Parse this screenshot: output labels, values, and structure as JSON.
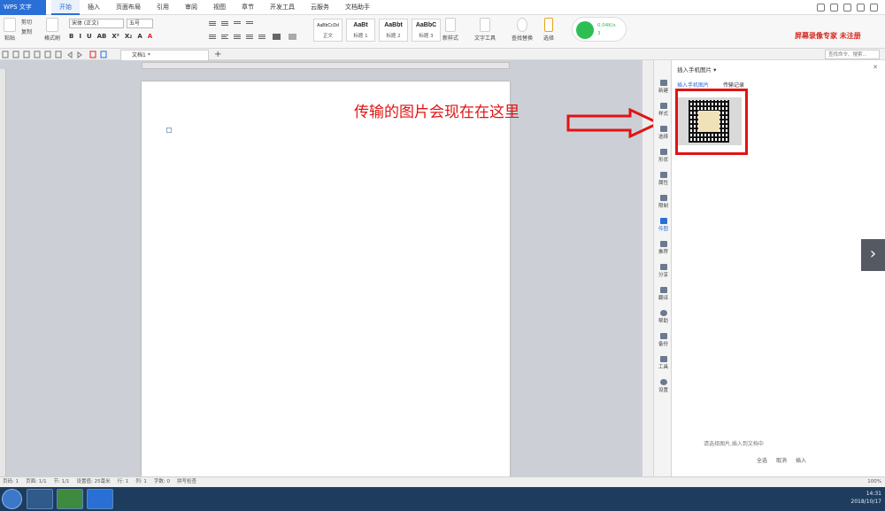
{
  "app": {
    "title": "WPS 文字"
  },
  "menu": {
    "tabs": [
      "开始",
      "插入",
      "页面布局",
      "引用",
      "审阅",
      "视图",
      "章节",
      "开发工具",
      "云服务",
      "文档助手"
    ]
  },
  "ribbon": {
    "paste": "粘贴",
    "cut": "剪切",
    "copy": "复制",
    "format_painter": "格式刷",
    "font": "宋体 (正文)",
    "font_size": "五号",
    "format_buttons": [
      "B",
      "I",
      "U",
      "AB",
      "X²",
      "X₂",
      "A",
      "A"
    ],
    "styles": [
      {
        "sample": "AaBbCcDd",
        "label": "正文"
      },
      {
        "sample": "AaBt",
        "label": "标题 1"
      },
      {
        "sample": "AaBbt",
        "label": "标题 2"
      },
      {
        "sample": "AaBbC",
        "label": "标题 3"
      }
    ],
    "new_style": "新样式",
    "text_tools": "文字工具",
    "find_replace": "查找替换",
    "select": "选择",
    "network_speed": "0.04K/s",
    "network_count": "3"
  },
  "watermark": "屏幕录像专家 未注册",
  "tabrow": {
    "doc_tab": "文档1 *",
    "add": "+",
    "search": "查找命令、搜索..."
  },
  "annotation": "传输的图片会现在在这里",
  "side_tools": [
    "新建",
    "样式",
    "选择",
    "形状",
    "属性",
    "限制",
    "传图",
    "推荐",
    "分享",
    "翻译",
    "帮助",
    "备份",
    "工具",
    "设置"
  ],
  "panel": {
    "title": "插入手机图片 ▾",
    "tabs": [
      "插入手机图片",
      "传输记录"
    ],
    "hint": "请选择图片,插入到文档中",
    "actions": [
      "全选",
      "取消",
      "插入"
    ]
  },
  "status": {
    "items": [
      "页码: 1",
      "页面: 1/1",
      "节: 1/1",
      "设置值: 25毫米",
      "行: 1",
      "列: 1",
      "字数: 0",
      "拼写检查"
    ],
    "zoom": "100%"
  },
  "taskbar": {
    "time": "14:31",
    "date": "2018/10/17"
  }
}
